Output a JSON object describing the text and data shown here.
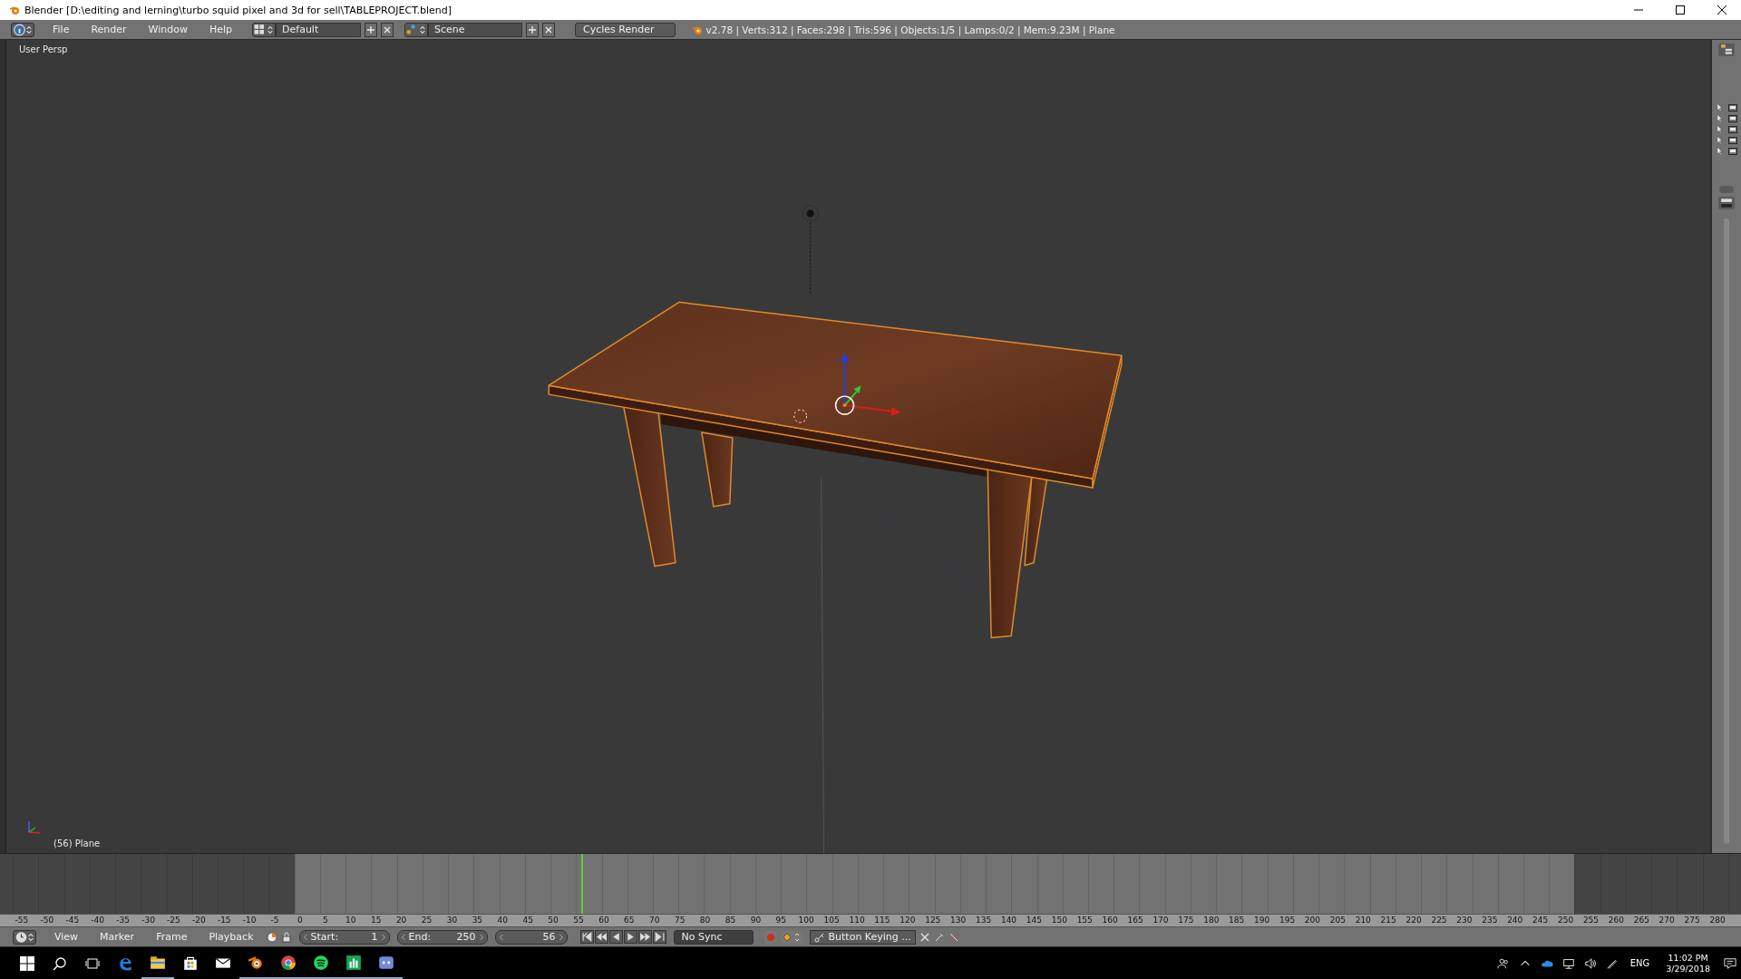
{
  "window": {
    "title": "Blender [D:\\editing and lerning\\turbo squid pixel and 3d for sell\\TABLEPROJECT.blend]"
  },
  "info_header": {
    "menus": [
      "File",
      "Render",
      "Window",
      "Help"
    ],
    "screen_layout": "Default",
    "scene": "Scene",
    "render_engine": "Cycles Render",
    "stats": "v2.78 | Verts:312 | Faces:298 | Tris:596 | Objects:1/5 | Lamps:0/2 | Mem:9.23M | Plane"
  },
  "viewport": {
    "view_name": "User Persp",
    "object_label": "(56) Plane"
  },
  "timeline": {
    "ruler": [
      "-55",
      "-50",
      "-45",
      "-40",
      "-35",
      "-30",
      "-25",
      "-20",
      "-15",
      "-10",
      "-5",
      "0",
      "5",
      "10",
      "15",
      "20",
      "25",
      "30",
      "35",
      "40",
      "45",
      "50",
      "55",
      "60",
      "65",
      "70",
      "75",
      "80",
      "85",
      "90",
      "95",
      "100",
      "105",
      "110",
      "115",
      "120",
      "125",
      "130",
      "135",
      "140",
      "145",
      "150",
      "155",
      "160",
      "165",
      "170",
      "175",
      "180",
      "185",
      "190",
      "195",
      "200",
      "205",
      "210",
      "215",
      "220",
      "225",
      "230",
      "235",
      "240",
      "245",
      "250",
      "255",
      "260",
      "265",
      "270",
      "275",
      "280"
    ],
    "menus": [
      "View",
      "Marker",
      "Frame",
      "Playback"
    ],
    "start_label": "Start:",
    "start": "1",
    "end_label": "End:",
    "end": "250",
    "current_frame": "56",
    "sync": "No Sync",
    "keying_set": "Button Keying ..."
  },
  "taskbar": {
    "apps": [
      {
        "kind": "edge",
        "running": false
      },
      {
        "kind": "explorer",
        "running": true
      },
      {
        "kind": "store",
        "running": false
      },
      {
        "kind": "mail",
        "running": false
      },
      {
        "kind": "blender",
        "running": true
      },
      {
        "kind": "chrome",
        "running": true
      },
      {
        "kind": "spotify",
        "running": true
      },
      {
        "kind": "chart",
        "running": true
      },
      {
        "kind": "discord",
        "running": true
      }
    ],
    "language": "ENG",
    "time": "11:02 PM",
    "date": "3/29/2018"
  }
}
